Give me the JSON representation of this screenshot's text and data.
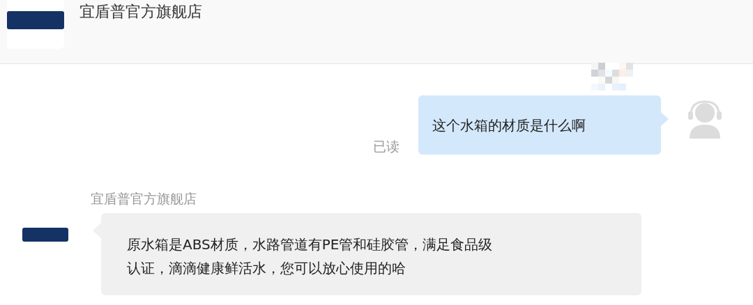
{
  "header": {
    "shop_name": "宜盾普官方旗舰店"
  },
  "messages": [
    {
      "kind": "outgoing",
      "text": "这个水箱的材质是什么啊",
      "receipt": "已读"
    },
    {
      "kind": "incoming",
      "sender": "宜盾普官方旗舰店",
      "lines": [
        "原水箱是ABS材质，水路管道有PE管和硅胶管，满足食品级",
        "认证，滴滴健康鲜活水，您可以放心使用的哈"
      ]
    }
  ]
}
